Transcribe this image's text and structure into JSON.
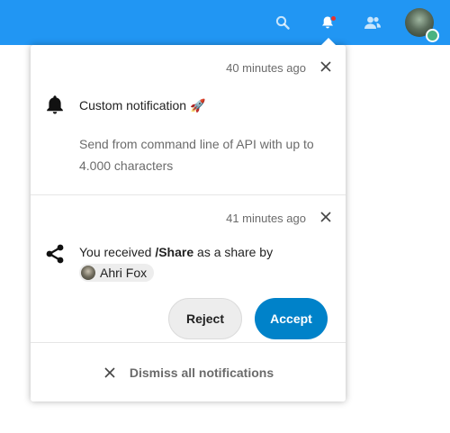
{
  "header": {
    "icons": [
      "search-icon",
      "notifications-icon",
      "contacts-icon",
      "avatar"
    ],
    "accent_color": "#2196f3",
    "unread_dot_color": "#e9322d",
    "status_color": "#49b382"
  },
  "notifications": [
    {
      "time": "40 minutes ago",
      "icon": "bell-icon",
      "subject": "Custom notification 🚀",
      "message": "Send from command line of API with up to 4.000 characters"
    },
    {
      "time": "41 minutes ago",
      "icon": "share-icon",
      "subject_prefix": "You received ",
      "subject_bold": "/Share",
      "subject_suffix": " as a share by",
      "user": "Ahri Fox",
      "actions": {
        "reject": "Reject",
        "accept": "Accept"
      }
    }
  ],
  "dismiss_all": "Dismiss all notifications",
  "colors": {
    "primary_button": "#0082c9",
    "secondary_button": "#ededed"
  }
}
